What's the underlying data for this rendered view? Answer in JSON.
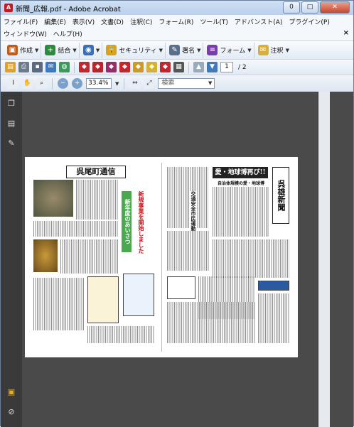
{
  "window": {
    "title": "新聞_広報.pdf - Adobe Acrobat",
    "app_icon": "A",
    "min": "0",
    "max": "□",
    "close": "✕"
  },
  "menu": {
    "row1": [
      "ファイル(F)",
      "編集(E)",
      "表示(V)",
      "文書(D)",
      "注釈(C)",
      "フォーム(R)",
      "ツール(T)",
      "アドバンスト(A)",
      "プラグイン(P)"
    ],
    "row2": [
      "ウィンドウ(W)",
      "ヘルプ(H)"
    ],
    "close_doc": "×"
  },
  "toolbar_tasks": [
    {
      "icon": "create-icon",
      "label": "作成",
      "color": "#c05b1a"
    },
    {
      "icon": "combine-icon",
      "label": "結合",
      "color": "#2e8b3d"
    },
    {
      "icon": "collaborate-icon",
      "label": "",
      "color": "#3a6fb8"
    },
    {
      "icon": "security-icon",
      "label": "セキュリティ",
      "color": "#d8a21a"
    },
    {
      "icon": "sign-icon",
      "label": "署名",
      "color": "#5a6f8a"
    },
    {
      "icon": "forms-icon",
      "label": "フォーム",
      "color": "#7a3ea8"
    },
    {
      "icon": "comment-icon",
      "label": "注釈",
      "color": "#d6b03a"
    }
  ],
  "toolbar_file": {
    "page_current": "1",
    "page_total": "/ 2"
  },
  "toolbar_view": {
    "zoom": "33.4%",
    "search_placeholder": "検索"
  },
  "document": {
    "left_title": "呉尾町通信",
    "right_title_vertical": "呉雄新聞",
    "right_banner": "愛・地球博再び!!",
    "right_subbanner": "自治体規模の愛・地球博",
    "right_vertical_head": "交通安全市民運動",
    "green_vertical": "新年度のあいさつ",
    "red_vertical": "新規事業を開始しました"
  }
}
